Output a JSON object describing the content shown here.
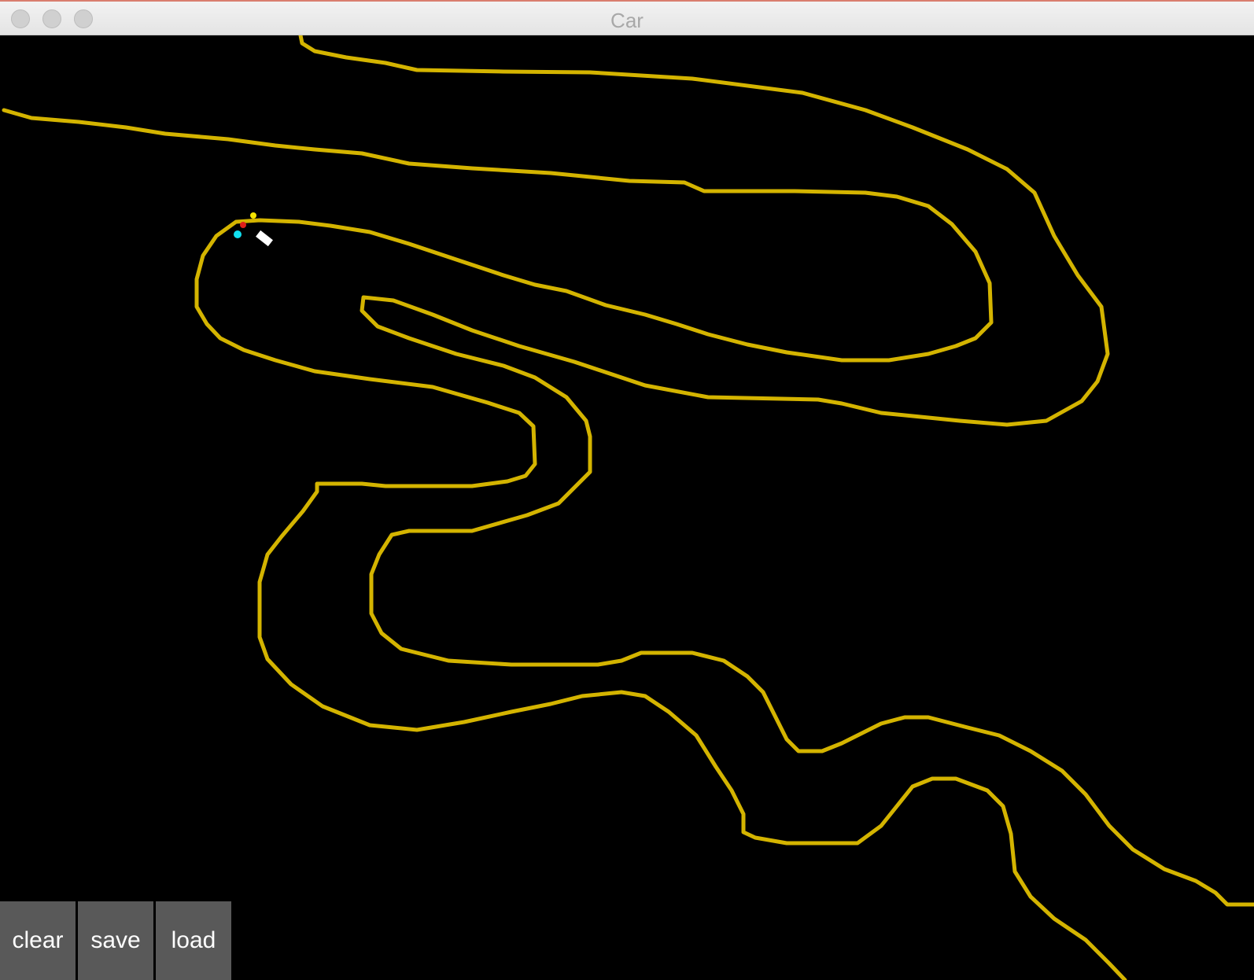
{
  "window": {
    "title": "Car"
  },
  "colors": {
    "track": "#d4b400",
    "background": "#000000",
    "car": "#ffffff",
    "sensor_red": "#e0201a",
    "sensor_yellow": "#f5e400",
    "sensor_cyan": "#11e0f0",
    "button_bg": "#595959",
    "button_text": "#ffffff"
  },
  "buttons": {
    "clear": "clear",
    "save": "save",
    "load": "load"
  },
  "icons": {
    "close": "close-icon",
    "minimize": "minimize-icon",
    "zoom": "zoom-icon"
  }
}
